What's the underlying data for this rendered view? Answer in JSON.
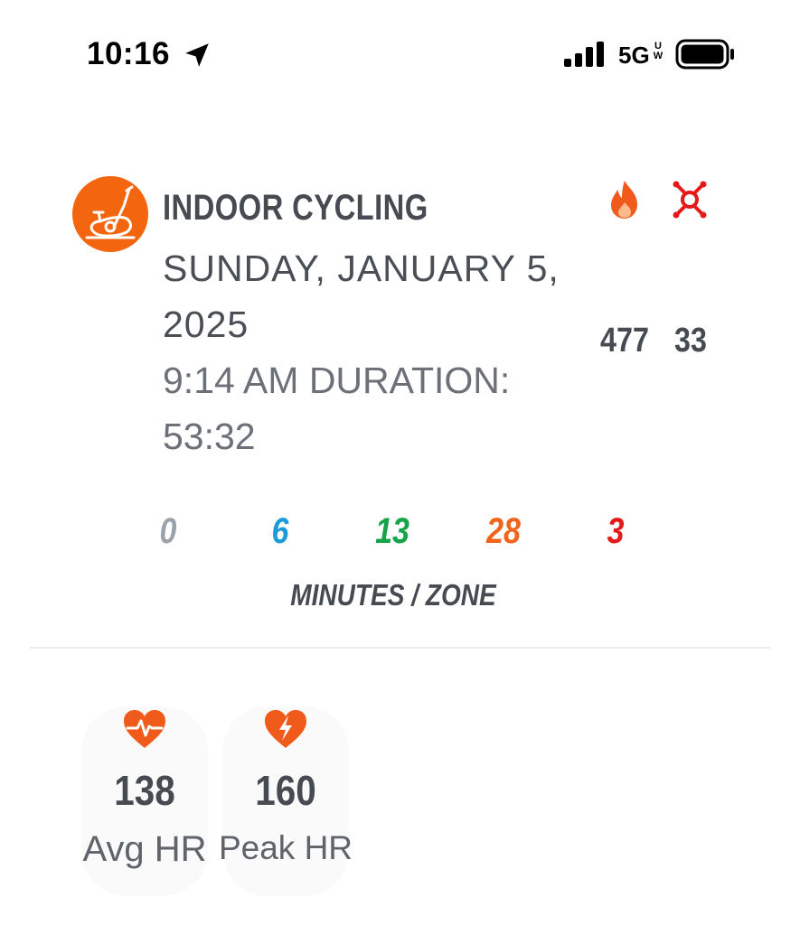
{
  "status_bar": {
    "time": "10:16",
    "network": "5G",
    "network_badge": "UW",
    "signal_bars": 4
  },
  "workout": {
    "title": "INDOOR CYCLING",
    "date": "SUNDAY, JANUARY 5, 2025",
    "time_duration": "9:14 AM DURATION: 53:32",
    "icon": "indoor-cycling-icon"
  },
  "stats": {
    "calories": "477",
    "splat_points": "33"
  },
  "zones": {
    "values": [
      "0",
      "6",
      "13",
      "28",
      "3"
    ],
    "colors": [
      "#9aa2a9",
      "#1a9ad6",
      "#16a34a",
      "#f26419",
      "#e51919"
    ],
    "label": "MINUTES / ZONE"
  },
  "heart_rate": {
    "avg": {
      "value": "138",
      "label": "Avg HR"
    },
    "peak": {
      "value": "160",
      "label": "Peak HR"
    }
  },
  "colors": {
    "accent": "#f3660f",
    "text": "#464b52",
    "heart": "#f05a1a",
    "splat": "#e51919"
  }
}
